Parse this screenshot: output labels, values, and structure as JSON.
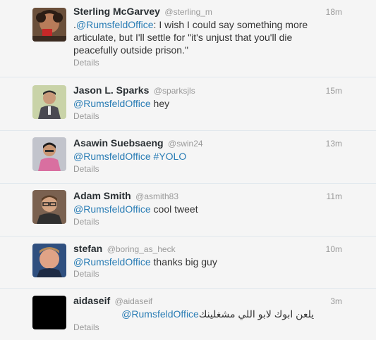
{
  "tweets": [
    {
      "fullname": "Sterling McGarvey",
      "username": "@sterling_m",
      "time": "18m",
      "text_pre": ".",
      "mention": "@RumsfeldOffice",
      "text_post": ": I wish I could say something more articulate, but I'll settle for \"it's unjust that you'll die peacefully outside prison.\"",
      "details": "Details"
    },
    {
      "fullname": "Jason L. Sparks",
      "username": "@sparksjls",
      "time": "15m",
      "mention": "@RumsfeldOffice",
      "text_post": " hey",
      "details": "Details"
    },
    {
      "fullname": "Asawin Suebsaeng",
      "username": "@swin24",
      "time": "13m",
      "mention": "@RumsfeldOffice",
      "hashtag": "#YOLO",
      "details": "Details"
    },
    {
      "fullname": "Adam Smith",
      "username": "@asmith83",
      "time": "11m",
      "mention": "@RumsfeldOffice",
      "text_post": " cool tweet",
      "details": "Details"
    },
    {
      "fullname": "stefan",
      "username": "@boring_as_heck",
      "time": "10m",
      "mention": "@RumsfeldOffice",
      "text_post": " thanks big guy",
      "details": "Details"
    },
    {
      "fullname": "aidaseif",
      "username": "@aidaseif",
      "time": "3m",
      "mention": "@RumsfeldOffice",
      "text_post": " يلعن ابوك لابو اللي مشغلينك",
      "details": "Details"
    }
  ]
}
